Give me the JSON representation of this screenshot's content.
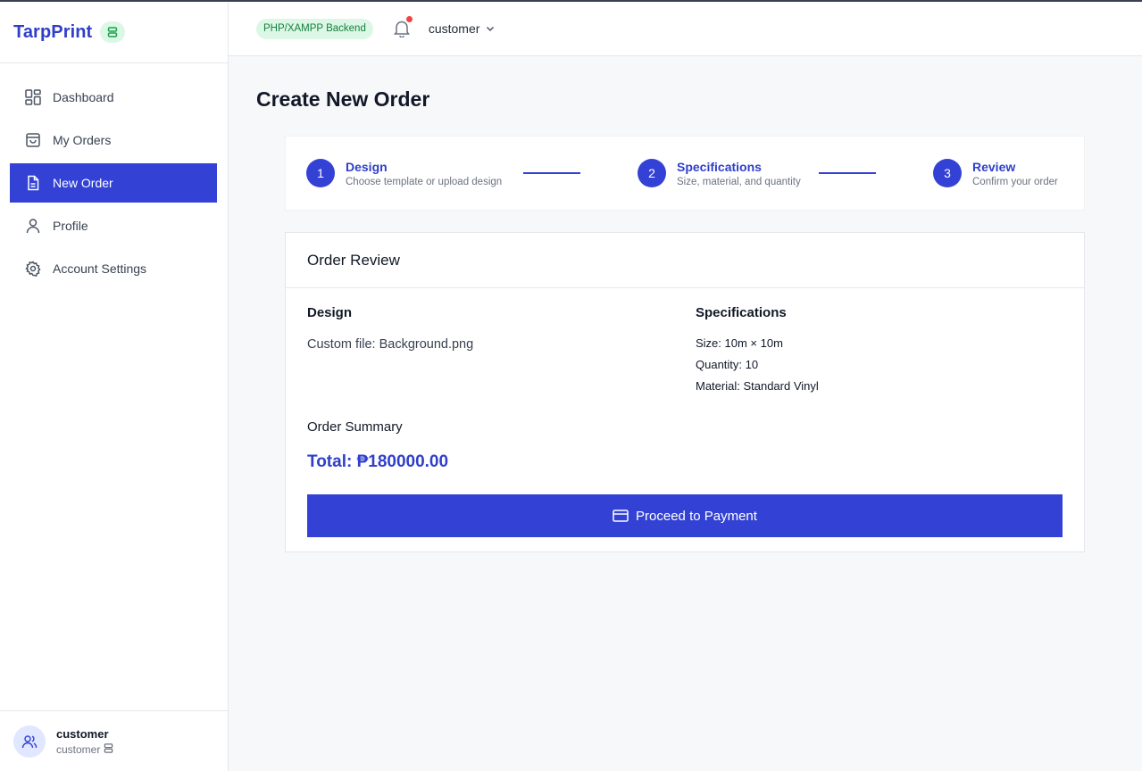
{
  "brand": {
    "name": "TarpPrint",
    "badge_icon": "database-icon"
  },
  "sidebar": {
    "items": [
      {
        "label": "Dashboard",
        "icon": "grid-icon",
        "active": false
      },
      {
        "label": "My Orders",
        "icon": "shopping-bag-icon",
        "active": false
      },
      {
        "label": "New Order",
        "icon": "document-icon",
        "active": true
      },
      {
        "label": "Profile",
        "icon": "user-icon",
        "active": false
      },
      {
        "label": "Account Settings",
        "icon": "gear-icon",
        "active": false
      }
    ]
  },
  "user_box": {
    "name": "customer",
    "role": "customer"
  },
  "topbar": {
    "backend_badge": "PHP/XAMPP Backend",
    "user_menu": "customer"
  },
  "page": {
    "title": "Create New Order"
  },
  "stepper": {
    "steps": [
      {
        "number": "1",
        "title": "Design",
        "subtitle": "Choose template or upload design"
      },
      {
        "number": "2",
        "title": "Specifications",
        "subtitle": "Size, material, and quantity"
      },
      {
        "number": "3",
        "title": "Review",
        "subtitle": "Confirm your order"
      }
    ]
  },
  "review": {
    "header": "Order Review",
    "design_title": "Design",
    "design_file": "Custom file: Background.png",
    "specs_title": "Specifications",
    "size": "Size: 10m × 10m",
    "quantity": "Quantity: 10",
    "material": "Material: Standard Vinyl",
    "summary_title": "Order Summary",
    "total": "Total: ₱180000.00",
    "pay_button": "Proceed to Payment"
  },
  "colors": {
    "accent": "#3342d4",
    "badge_bg": "#dcf7e6",
    "badge_text": "#15803d",
    "notification": "#ef4444"
  }
}
